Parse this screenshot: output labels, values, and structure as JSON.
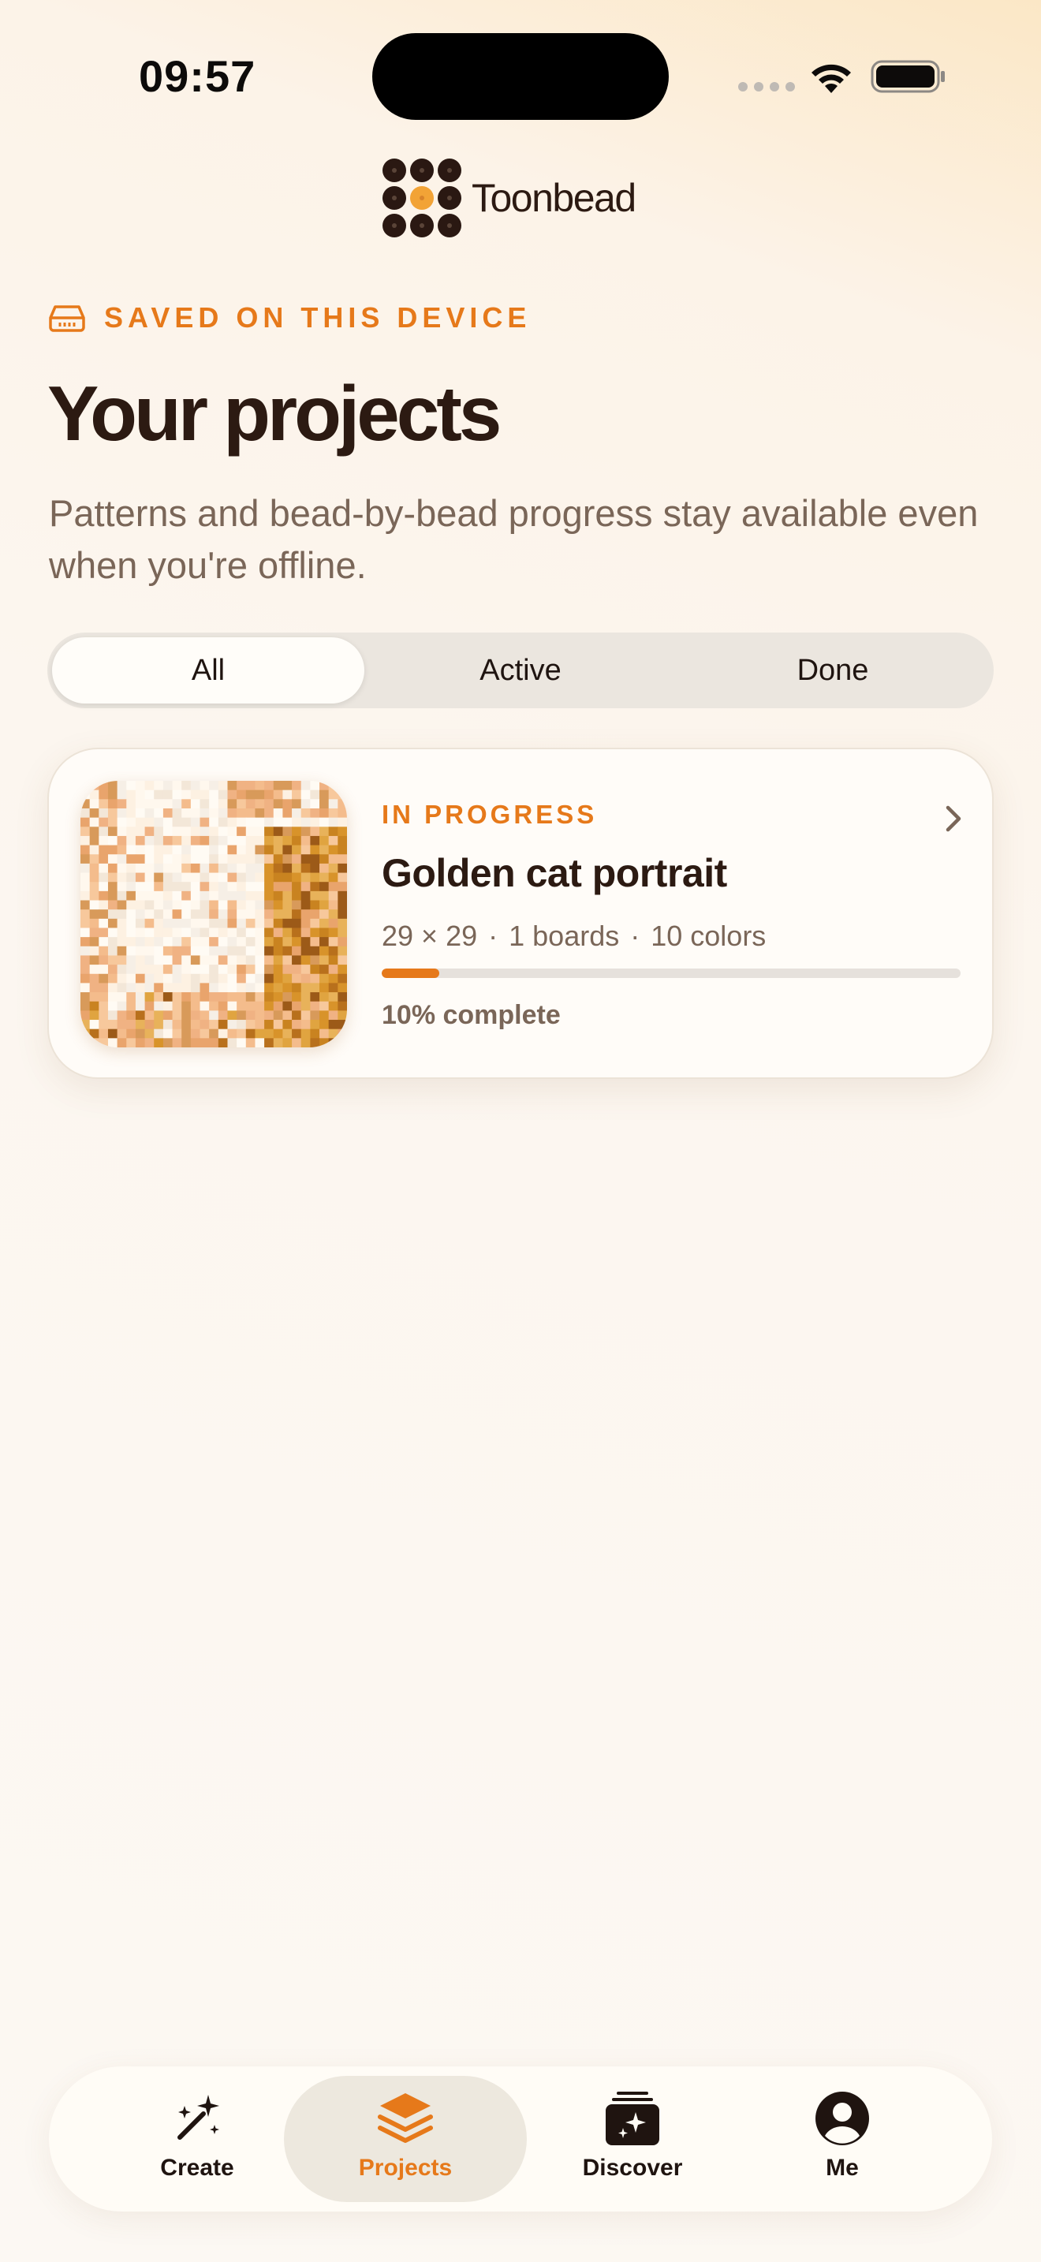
{
  "status_bar": {
    "time": "09:57"
  },
  "brand": {
    "name": "Toonbead"
  },
  "header": {
    "eyebrow": "SAVED ON THIS DEVICE",
    "eyebrow_icon": "storage-drive-icon",
    "title": "Your projects",
    "subtitle": "Patterns and bead-by-bead progress stay available even when you're offline."
  },
  "filter": {
    "segments": [
      "All",
      "Active",
      "Done"
    ],
    "selected": "All"
  },
  "projects": [
    {
      "status": "IN PROGRESS",
      "title": "Golden cat portrait",
      "size": "29 × 29",
      "boards": "1 boards",
      "colors": "10 colors",
      "separator": "·",
      "progress_fraction": 0.1,
      "progress_label": "10% complete"
    }
  ],
  "tabbar": {
    "items": [
      {
        "label": "Create",
        "icon": "magic-wand-icon"
      },
      {
        "label": "Projects",
        "icon": "layers-icon"
      },
      {
        "label": "Discover",
        "icon": "sparkle-cards-icon"
      },
      {
        "label": "Me",
        "icon": "person-circle-icon"
      }
    ],
    "active": "Projects"
  },
  "colors": {
    "accent": "#e6791a",
    "text_dark": "#2c1a12",
    "text_muted": "#7a6658",
    "background": "#fcf6ef"
  }
}
